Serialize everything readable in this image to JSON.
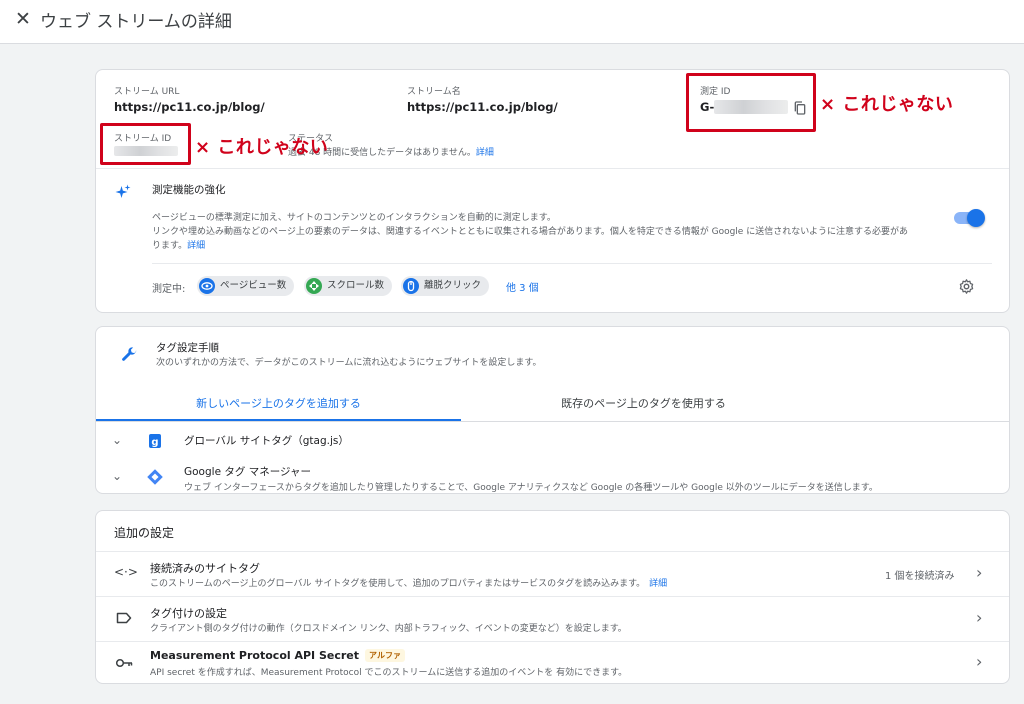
{
  "header": {
    "close_icon": "close-icon",
    "title": "ウェブ ストリームの詳細"
  },
  "stream_info": {
    "url_label": "ストリーム URL",
    "url_value": "https://pc11.co.jp/blog/",
    "name_label": "ストリーム名",
    "name_value": "https://pc11.co.jp/blog/",
    "measurement_label": "測定 ID",
    "measurement_prefix": "G-",
    "stream_id_label": "ストリーム ID",
    "status_label": "ステータス",
    "status_text": "過去 48 時間に受信したデータはありません。",
    "status_link": "詳細"
  },
  "annotations": {
    "wrong_1": "× これじゃない",
    "wrong_2": "× これじゃない",
    "color": "#d0021b"
  },
  "enhanced": {
    "title": "測定機能の強化",
    "desc_line1": "ページビューの標準測定に加え、サイトのコンテンツとのインタラクションを自動的に測定します。",
    "desc_line2": "リンクや埋め込み動画などのページ上の要素のデータは、関連するイベントとともに収集される場合があります。個人を特定できる情報が Google に送信されないように注意する必要があ",
    "desc_line3": "ります。",
    "desc_link": "詳細",
    "measuring_label": "測定中:",
    "chips": [
      {
        "label": "ページビュー数",
        "icon": "eye-icon",
        "color": "#1a73e8"
      },
      {
        "label": "スクロール数",
        "icon": "scroll-icon",
        "color": "#34a853"
      },
      {
        "label": "離脱クリック",
        "icon": "click-icon",
        "color": "#1a73e8"
      }
    ],
    "more_link": "他 3 個",
    "toggle_on": true
  },
  "tagging": {
    "title": "タグ設定手順",
    "desc": "次のいずれかの方法で、データがこのストリームに流れ込むようにウェブサイトを設定します。",
    "tabs": [
      {
        "label": "新しいページ上のタグを追加する",
        "active": true
      },
      {
        "label": "既存のページ上のタグを使用する",
        "active": false
      }
    ],
    "options": [
      {
        "title": "グローバル サイトタグ（gtag.js）",
        "desc": ""
      },
      {
        "title": "Google タグ マネージャー",
        "desc": "ウェブ インターフェースからタグを追加したり管理したりすることで、Google アナリティクスなど Google の各種ツールや Google 以外のツールにデータを送信します。"
      }
    ]
  },
  "additional": {
    "title": "追加の設定",
    "rows": [
      {
        "title": "接続済みのサイトタグ",
        "desc": "このストリームのページ上のグローバル サイトタグを使用して、追加のプロパティまたはサービスのタグを読み込みます。",
        "link": "詳細",
        "status": "1 個を接続済み",
        "icon": "code-icon"
      },
      {
        "title": "タグ付けの設定",
        "desc": "クライアント側のタグ付けの動作（クロスドメイン リンク、内部トラフィック、イベントの変更など）を設定します。",
        "link": "",
        "status": "",
        "icon": "label-icon"
      },
      {
        "title": "Measurement Protocol API Secret",
        "badge": "アルファ",
        "desc": "API secret を作成すれば、Measurement Protocol でこのストリームに送信する追加のイベントを 有効にできます。",
        "link": "",
        "status": "",
        "icon": "key-icon"
      }
    ]
  }
}
